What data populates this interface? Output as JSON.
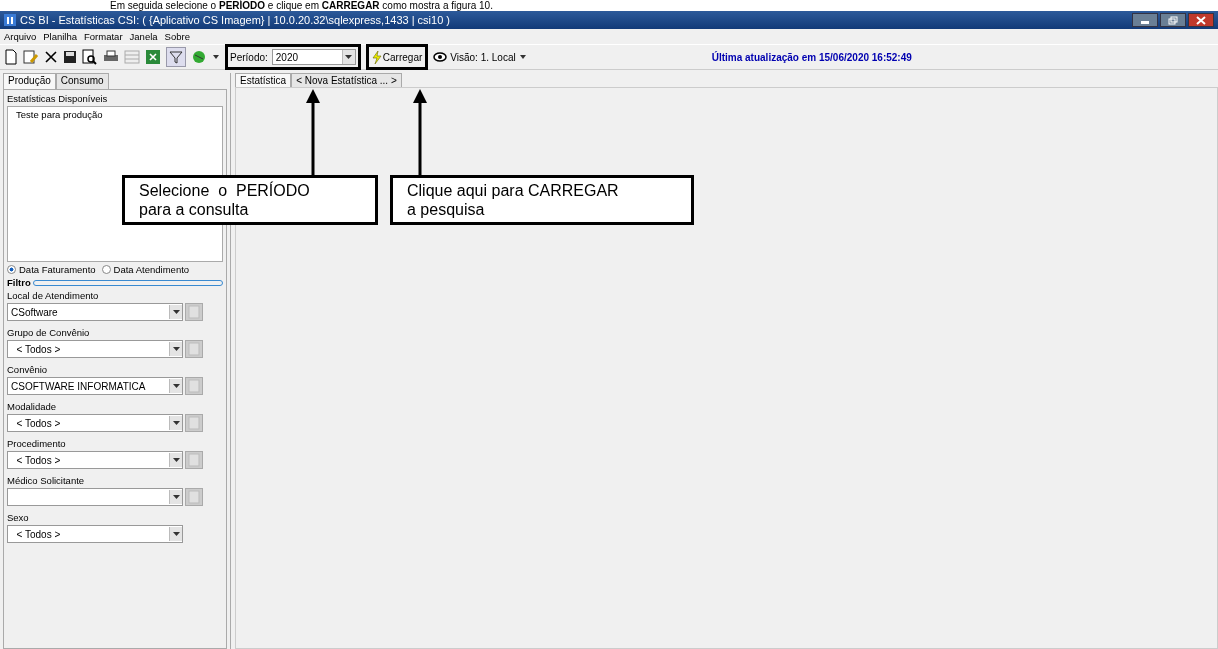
{
  "caption": "Em seguida selecione o **PERÍODO** e clique em **CARREGAR** como mostra a figura 10.",
  "window": {
    "title": "CS BI - Estatísticas CSI: ( {Aplicativo CS Imagem} | 10.0.20.32\\sqlexpress,1433 | csi10 )"
  },
  "menu": [
    "Arquivo",
    "Planilha",
    "Formatar",
    "Janela",
    "Sobre"
  ],
  "toolbar": {
    "period_label": "Período:",
    "period_value": "2020",
    "load_button": "Carregar",
    "view_label": "Visão: 1. Local",
    "last_update": "Última atualização em 15/06/2020 16:52:49"
  },
  "left_tabs": [
    {
      "label": "Produção",
      "selected": true
    },
    {
      "label": "Consumo",
      "selected": false
    }
  ],
  "stats": {
    "label": "Estatísticas Disponíveis",
    "items": [
      "Teste para produção"
    ]
  },
  "date_options": [
    {
      "label": "Data Faturamento",
      "selected": true
    },
    {
      "label": "Data Atendimento",
      "selected": false
    }
  ],
  "filter_title": "Filtro",
  "filters": [
    {
      "label": "Local de Atendimento",
      "value": "CSoftware",
      "kind": "combo-list"
    },
    {
      "label": "Grupo de Convênio",
      "value": "  < Todos >",
      "kind": "combo-list"
    },
    {
      "label": "Convênio",
      "value": "CSOFTWARE INFORMATICA",
      "kind": "combo-list"
    },
    {
      "label": "Modalidade",
      "value": "  < Todos >",
      "kind": "combo-list"
    },
    {
      "label": "Procedimento",
      "value": "  < Todos >",
      "kind": "combo-list"
    },
    {
      "label": "Médico Solicitante",
      "kind": "combo-list"
    },
    {
      "label": "Sexo",
      "value": "  < Todos >",
      "kind": "combo"
    }
  ],
  "doc_tabs": [
    {
      "label": "Estatística",
      "selected": true
    },
    {
      "label": "< Nova Estatística ... >",
      "selected": false
    }
  ],
  "callouts": [
    "Selecione  o  PERÍODO\npara a consulta",
    "Clique aqui para CARREGAR\na pesquisa"
  ]
}
